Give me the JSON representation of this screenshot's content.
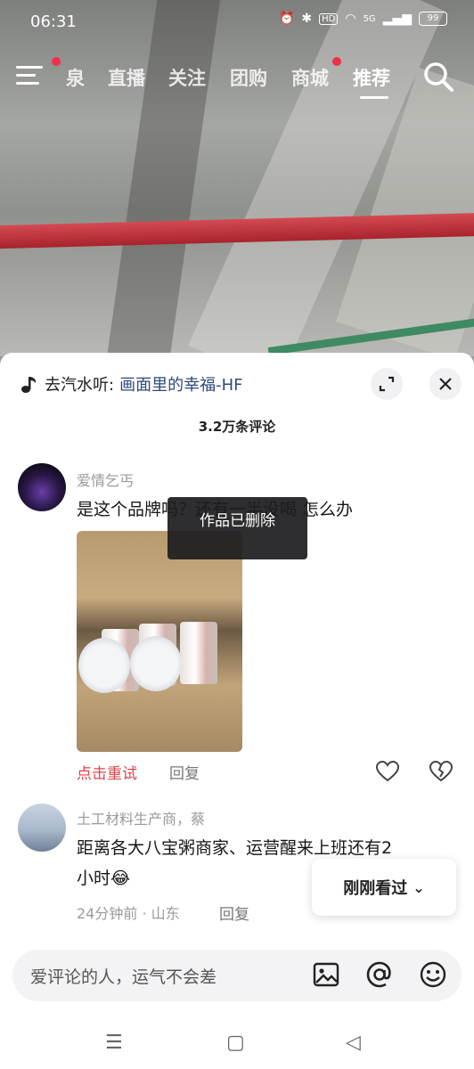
{
  "status_bar": {
    "time": "06:31",
    "hd_label": "HD",
    "network_label": "5G",
    "battery_level": "99"
  },
  "top_nav": {
    "tabs": [
      {
        "label": "泉"
      },
      {
        "label": "直播"
      },
      {
        "label": "关注"
      },
      {
        "label": "团购"
      },
      {
        "label": "商城"
      },
      {
        "label": "推荐",
        "active": true
      }
    ]
  },
  "comments_sheet": {
    "music_prefix": "去汽水听:",
    "song_name": "画面里的幸福-HF",
    "title": "3.2万条评论",
    "toast": "作品已删除",
    "comments": [
      {
        "username": "爱情乞丐",
        "text": "是这个品牌吗？还有一半没喝  怎么办",
        "retry_label": "点击重试",
        "reply_label": "回复"
      },
      {
        "username": "土工材料生产商，蔡",
        "text_line1": "距离各大八宝粥商家、运营醒来上班还有2",
        "text_line2": "小时😂",
        "meta": "24分钟前 · 山东",
        "reply_label": "回复"
      }
    ],
    "recent_button_label": "刚刚看过",
    "input_placeholder": "爱评论的人，运气不会差"
  },
  "colors": {
    "accent_red": "#e0434a",
    "link_blue": "#2c4a7a",
    "notification_dot": "#f2304a"
  },
  "icons": {
    "menu": "menu-icon",
    "search": "search-icon",
    "music_note": "music-note-icon",
    "expand": "expand-icon",
    "close": "close-icon",
    "like": "heart-icon",
    "dislike": "broken-heart-icon",
    "image": "image-icon",
    "mention": "at-icon",
    "emoji": "emoji-icon"
  }
}
